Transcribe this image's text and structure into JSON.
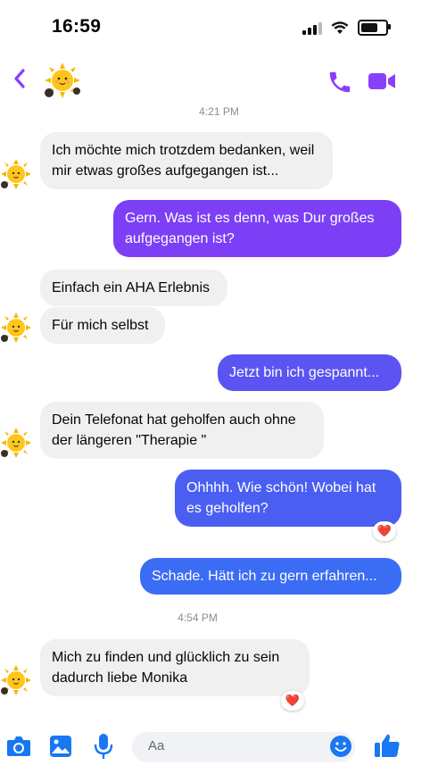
{
  "status_bar": {
    "time": "16:59"
  },
  "header": {
    "back_icon": "chevron-left-icon",
    "phone_icon": "phone-icon",
    "video_icon": "video-camera-icon",
    "accent": "#8a3ffc"
  },
  "timestamps": [
    "4:21 PM",
    "4:54 PM"
  ],
  "messages": [
    {
      "from": "contact",
      "text": "Ich möchte mich trotzdem bedanken, weil mir etwas großes aufgegangen ist..."
    },
    {
      "from": "me",
      "text": "Gern. Was ist es denn, was Dur großes aufgegangen ist?"
    },
    {
      "from": "contact",
      "text": "Einfach ein AHA Erlebnis"
    },
    {
      "from": "contact",
      "text": "Für mich selbst"
    },
    {
      "from": "me",
      "text": "Jetzt bin ich gespannt..."
    },
    {
      "from": "contact",
      "text": "Dein Telefonat hat geholfen auch ohne der längeren \"Therapie \""
    },
    {
      "from": "me",
      "text": "Ohhhh. Wie schön! Wobei hat es geholfen?",
      "reaction": "❤️"
    },
    {
      "from": "me",
      "text": "Schade. Hätt ich zu gern erfahren..."
    },
    {
      "from": "contact",
      "text": "Mich zu finden und glücklich zu sein dadurch liebe Monika",
      "reaction": "❤️"
    }
  ],
  "composer": {
    "placeholder": "Aa",
    "icons": [
      "camera-icon",
      "image-icon",
      "microphone-icon",
      "emoji-icon",
      "thumbs-up-icon"
    ],
    "accent": "#1877f2"
  }
}
